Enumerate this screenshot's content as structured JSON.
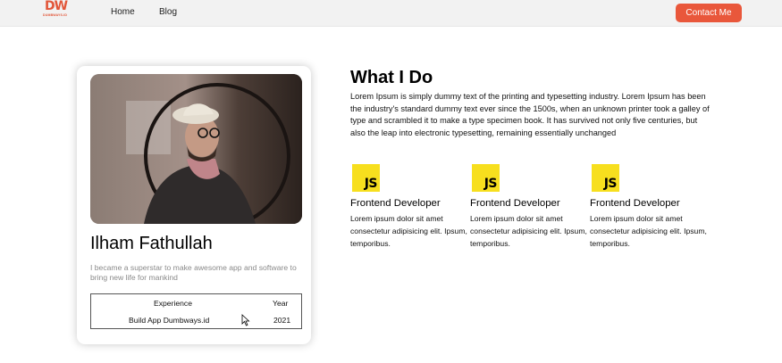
{
  "brand": {
    "logo_mark": "DW",
    "logo_text": "DUMBWAYS.ID",
    "accent": "#e9573b"
  },
  "nav": {
    "links": [
      "Home",
      "Blog"
    ],
    "contact_label": "Contact Me"
  },
  "profile": {
    "name": "Ilham Fathullah",
    "bio": "I became a superstar to make awesome app and software to bring new life for mankind",
    "table": {
      "headers": [
        "Experience",
        "Year"
      ],
      "rows": [
        {
          "experience": "Build App Dumbways.id",
          "year": "2021"
        }
      ]
    }
  },
  "what_i_do": {
    "title": "What I Do",
    "description": "Lorem Ipsum is simply dummy text of the printing and typesetting industry. Lorem Ipsum has been the industry's standard dummy text ever since the 1500s, when an unknown printer took a galley of type and scrambled it to make a type specimen book. It has survived not only five centuries, but also the leap into electronic typesetting, remaining essentially unchanged",
    "skills": [
      {
        "icon": "javascript-icon",
        "badge": "JS",
        "title": "Frontend Developer",
        "desc": "Lorem ipsum dolor sit amet consectetur adipisicing elit. Ipsum, temporibus."
      },
      {
        "icon": "javascript-icon",
        "badge": "JS",
        "title": "Frontend Developer",
        "desc": "Lorem ipsum dolor sit amet consectetur adipisicing elit. Ipsum, temporibus."
      },
      {
        "icon": "javascript-icon",
        "badge": "JS",
        "title": "Frontend Developer",
        "desc": "Lorem ipsum dolor sit amet consectetur adipisicing elit. Ipsum, temporibus."
      }
    ]
  }
}
